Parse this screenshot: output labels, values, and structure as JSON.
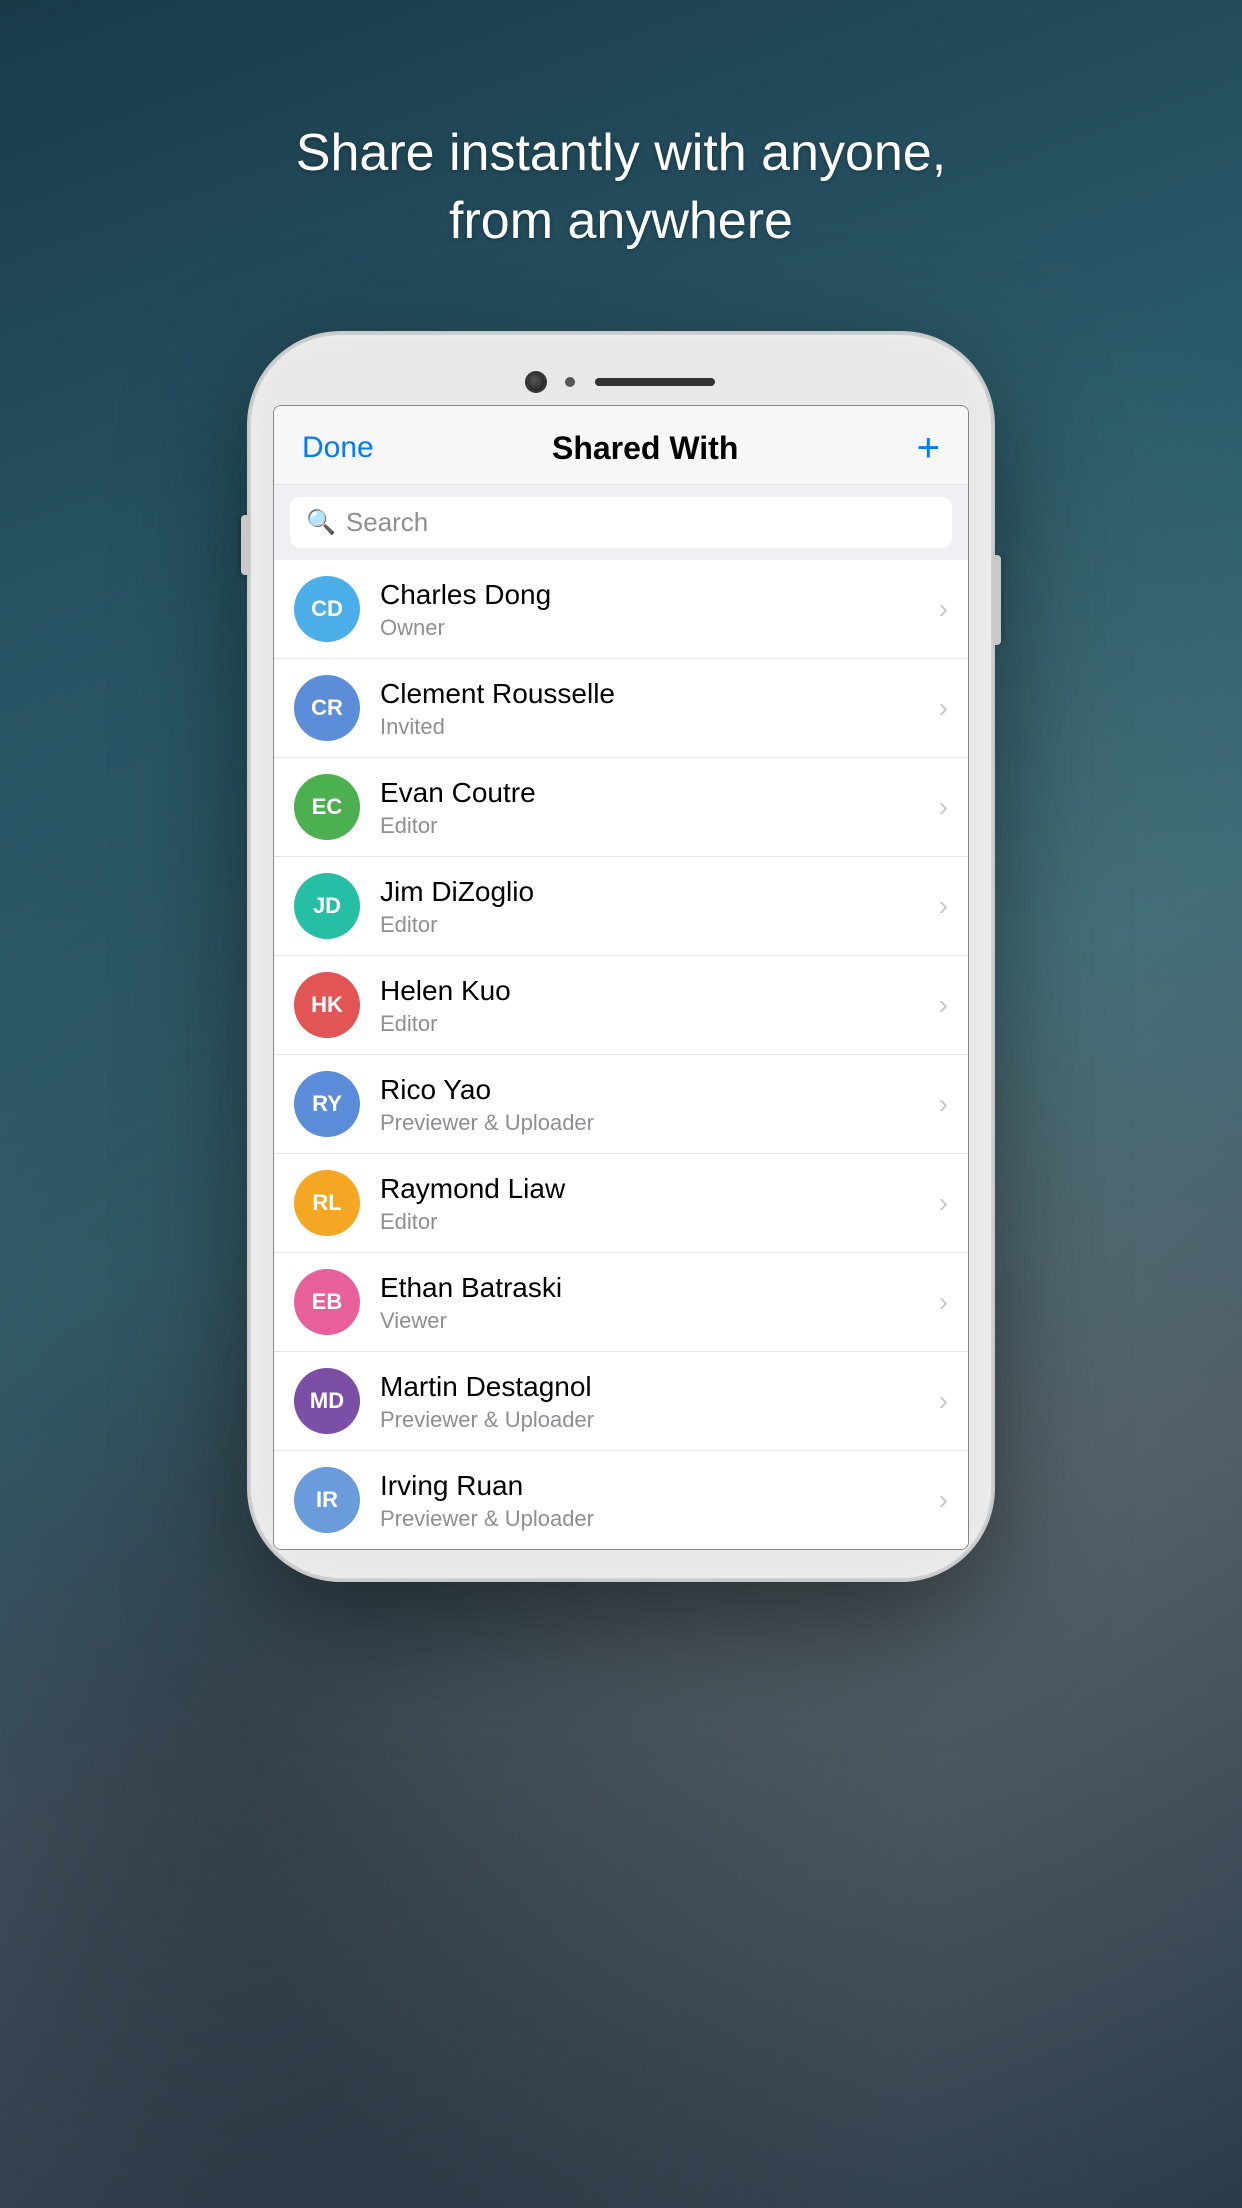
{
  "background": {
    "tagline_line1": "Share instantly with anyone,",
    "tagline_line2": "from anywhere"
  },
  "nav": {
    "done_label": "Done",
    "title": "Shared With",
    "add_icon": "+"
  },
  "search": {
    "placeholder": "Search"
  },
  "people": [
    {
      "initials": "CD",
      "name": "Charles Dong",
      "role": "Owner",
      "color": "#4BAEE8"
    },
    {
      "initials": "CR",
      "name": "Clement Rousselle",
      "role": "Invited",
      "color": "#5B8DD9"
    },
    {
      "initials": "EC",
      "name": "Evan Coutre",
      "role": "Editor",
      "color": "#4CAF50"
    },
    {
      "initials": "JD",
      "name": "Jim DiZoglio",
      "role": "Editor",
      "color": "#26BFA5"
    },
    {
      "initials": "HK",
      "name": "Helen Kuo",
      "role": "Editor",
      "color": "#E25555"
    },
    {
      "initials": "RY",
      "name": "Rico Yao",
      "role": "Previewer & Uploader",
      "color": "#5B8DD9"
    },
    {
      "initials": "RL",
      "name": "Raymond Liaw",
      "role": "Editor",
      "color": "#F5A623"
    },
    {
      "initials": "EB",
      "name": "Ethan Batraski",
      "role": "Viewer",
      "color": "#E8609A"
    },
    {
      "initials": "MD",
      "name": "Martin Destagnol",
      "role": "Previewer & Uploader",
      "color": "#7B4FA6"
    },
    {
      "initials": "IR",
      "name": "Irving Ruan",
      "role": "Previewer & Uploader",
      "color": "#6A9BDA"
    }
  ]
}
